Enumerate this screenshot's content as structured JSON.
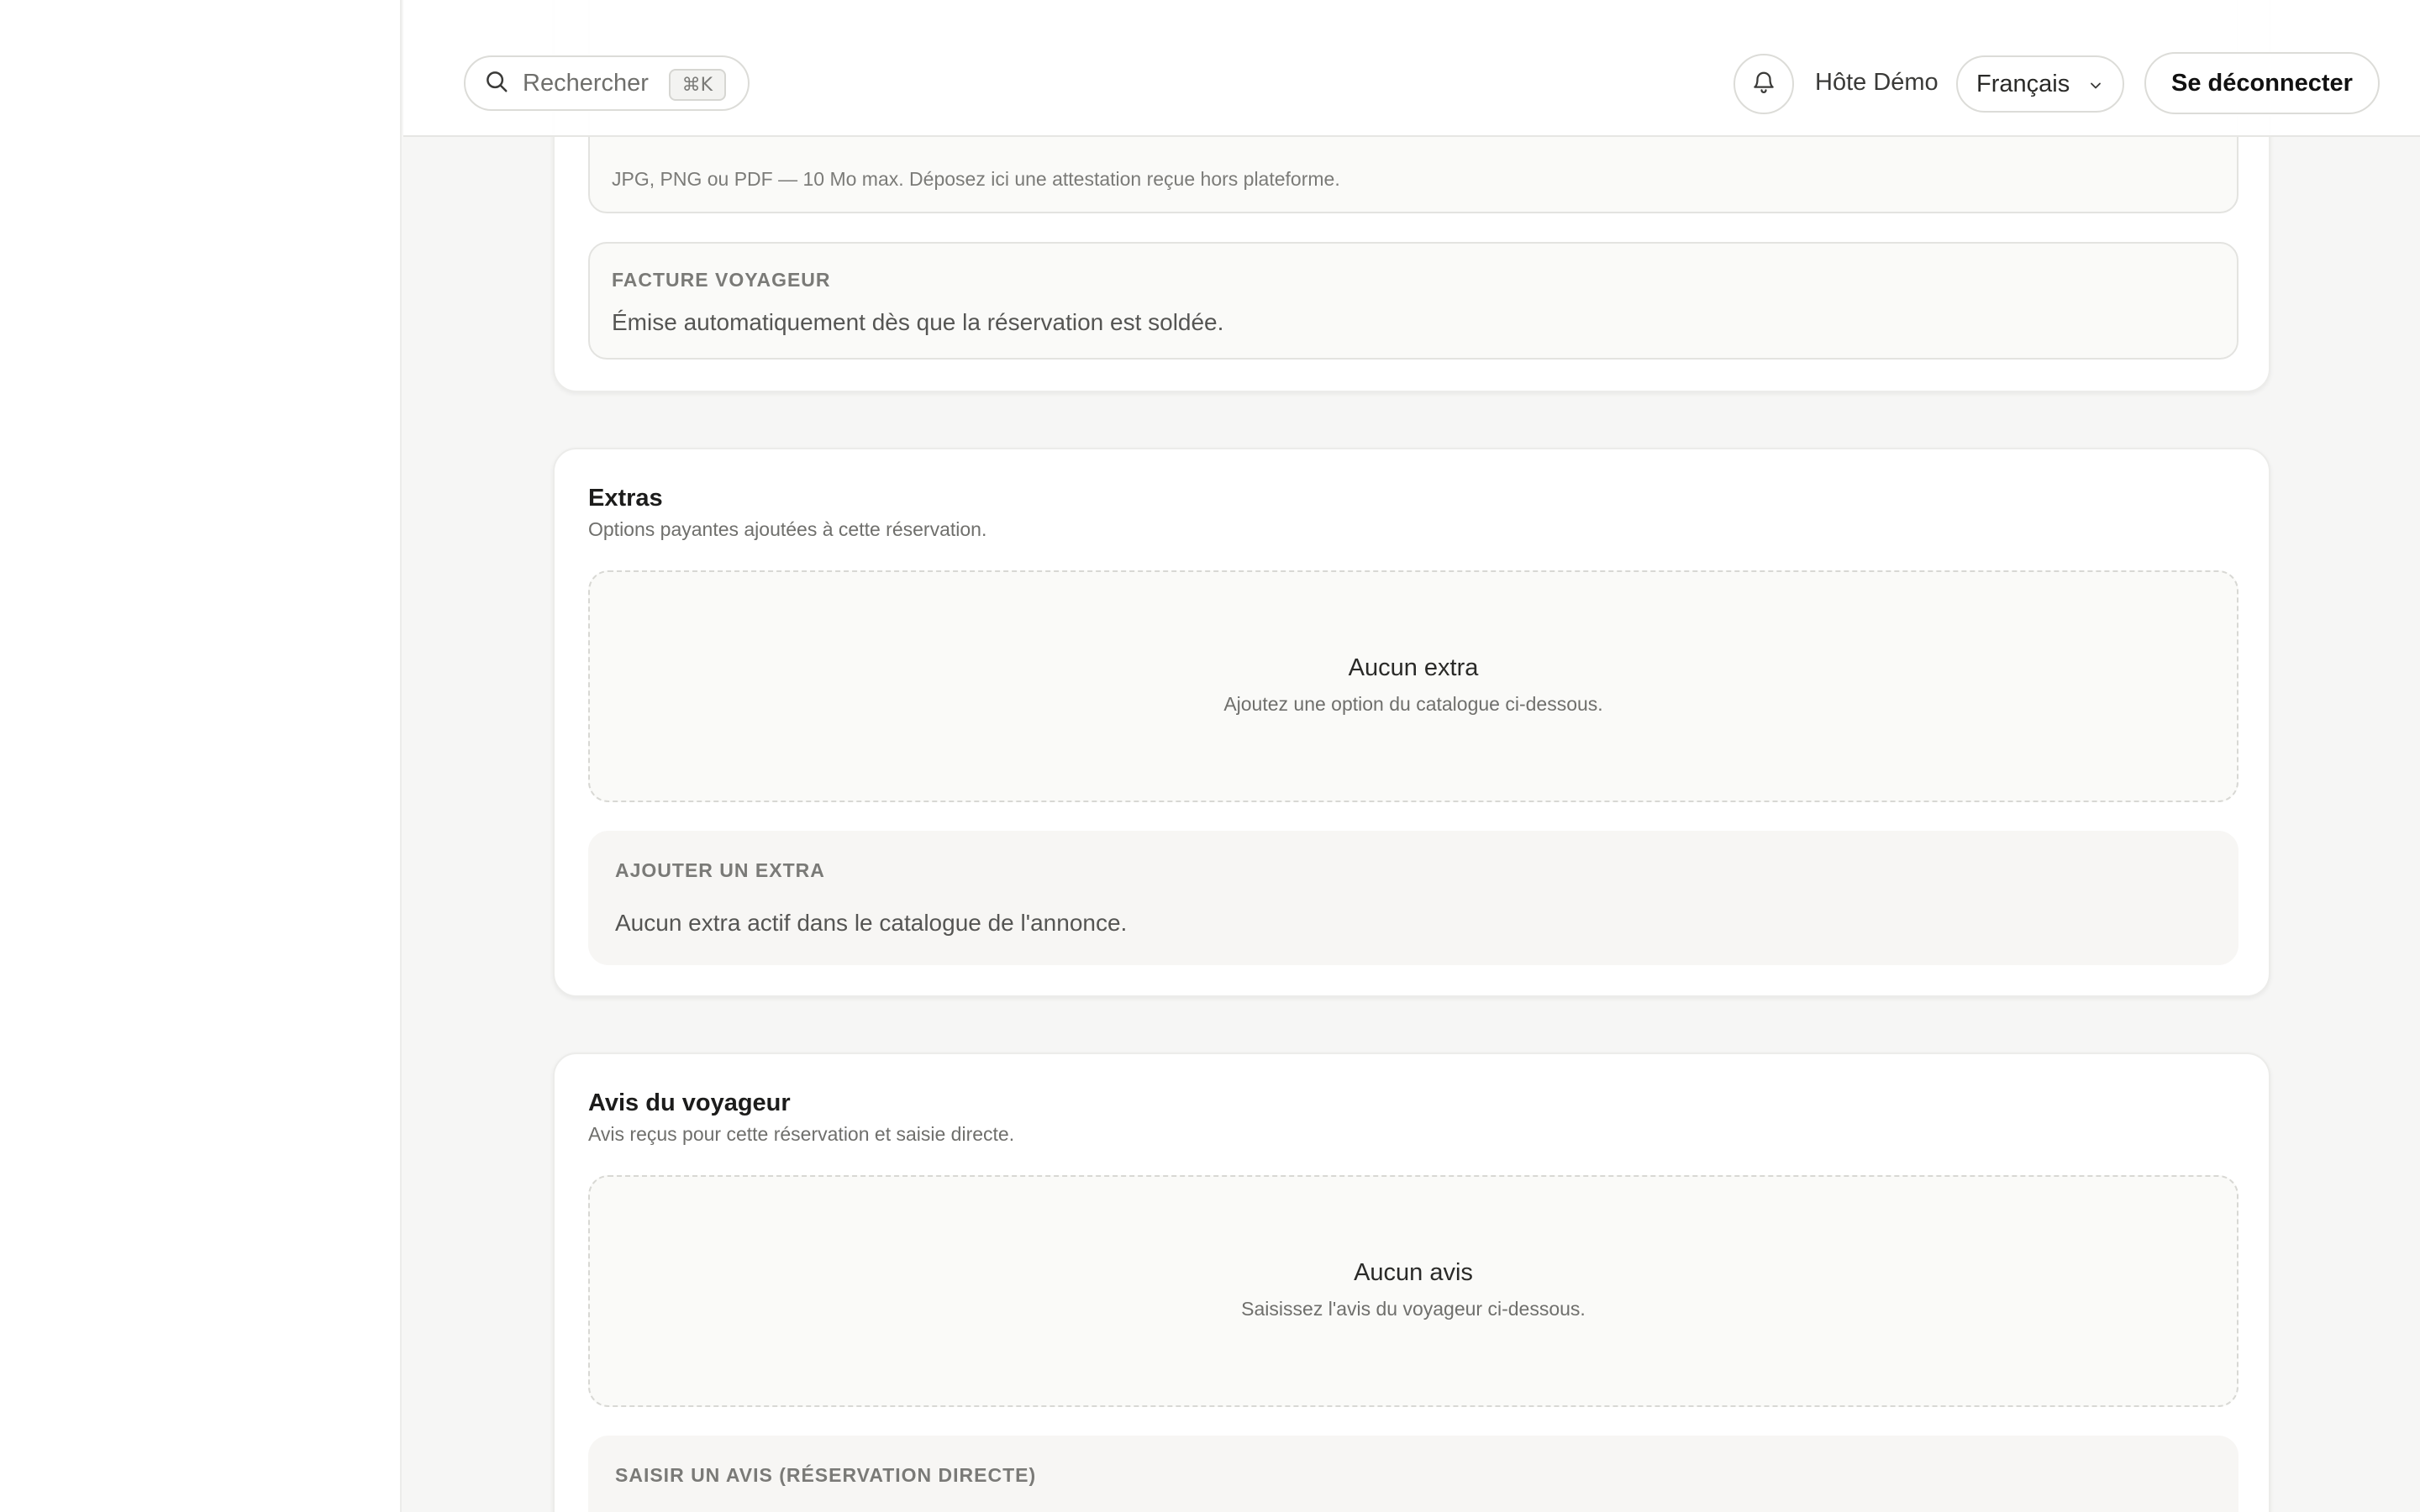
{
  "topbar": {
    "search_placeholder": "Rechercher",
    "search_shortcut": "⌘K",
    "user_name": "Hôte Démo",
    "language": "Français",
    "logout_label": "Se déconnecter"
  },
  "documents": {
    "upload_hint": "JPG, PNG ou PDF — 10 Mo max. Déposez ici une attestation reçue hors plateforme.",
    "invoice_label": "FACTURE VOYAGEUR",
    "invoice_text": "Émise automatiquement dès que la réservation est soldée."
  },
  "extras": {
    "title": "Extras",
    "subtitle": "Options payantes ajoutées à cette réservation.",
    "empty_title": "Aucun extra",
    "empty_subtitle": "Ajoutez une option du catalogue ci-dessous.",
    "add_label": "AJOUTER UN EXTRA",
    "add_text": "Aucun extra actif dans le catalogue de l'annonce."
  },
  "reviews": {
    "title": "Avis du voyageur",
    "subtitle": "Avis reçus pour cette réservation et saisie directe.",
    "empty_title": "Aucun avis",
    "empty_subtitle": "Saisissez l'avis du voyageur ci-dessous.",
    "add_label": "SAISIR UN AVIS (RÉSERVATION DIRECTE)"
  }
}
